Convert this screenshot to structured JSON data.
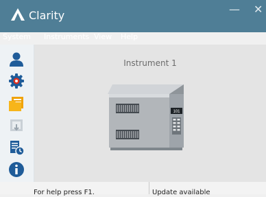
{
  "window": {
    "title": "Clarity",
    "minimize_glyph": "—",
    "close_glyph": "✕"
  },
  "menu": [
    {
      "label": "System"
    },
    {
      "label": "Instruments"
    },
    {
      "label": "View"
    },
    {
      "label": "Help"
    }
  ],
  "toolbar": [
    {
      "icon": "user-icon"
    },
    {
      "icon": "gear-icon"
    },
    {
      "icon": "folder-icon"
    },
    {
      "icon": "import-icon",
      "disabled": true
    },
    {
      "icon": "report-schedule-icon"
    },
    {
      "icon": "info-icon"
    }
  ],
  "instrument": {
    "label": "Instrument 1",
    "display_text": "101"
  },
  "status": {
    "help": "For help press F1.",
    "update": "Update available"
  },
  "colors": {
    "titlebar": "#4f7e96",
    "toolbar_icon": "#1f5c99",
    "folder": "#f0a30a",
    "content_bg": "#e4e4e4"
  }
}
